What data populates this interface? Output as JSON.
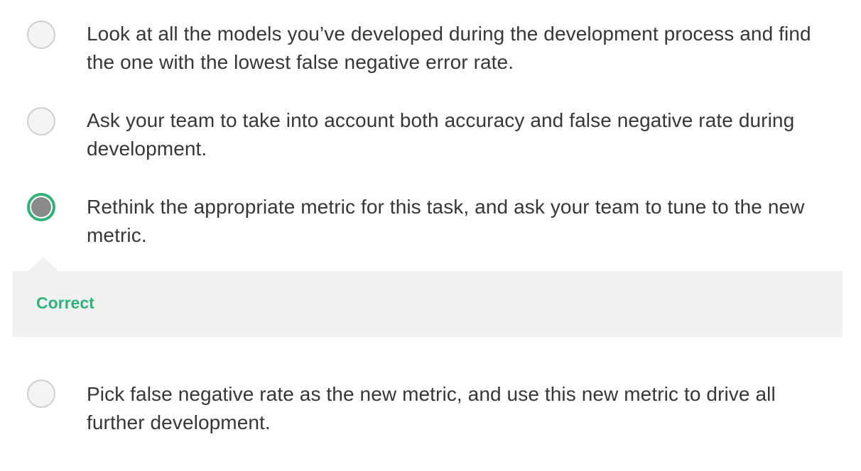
{
  "options": [
    {
      "text": "Look at all the models you’ve developed during the development process and find the one with the lowest false negative error rate.",
      "selected": false
    },
    {
      "text": "Ask your team to take into account both accuracy and false negative rate during development.",
      "selected": false
    },
    {
      "text": "Rethink the appropriate metric for this task, and ask your team to tune to the new metric.",
      "selected": true
    },
    {
      "text": "Pick false negative rate as the new metric, and use this new metric to drive all further development.",
      "selected": false
    }
  ],
  "feedback": {
    "label": "Correct",
    "color": "#2fb37a"
  }
}
